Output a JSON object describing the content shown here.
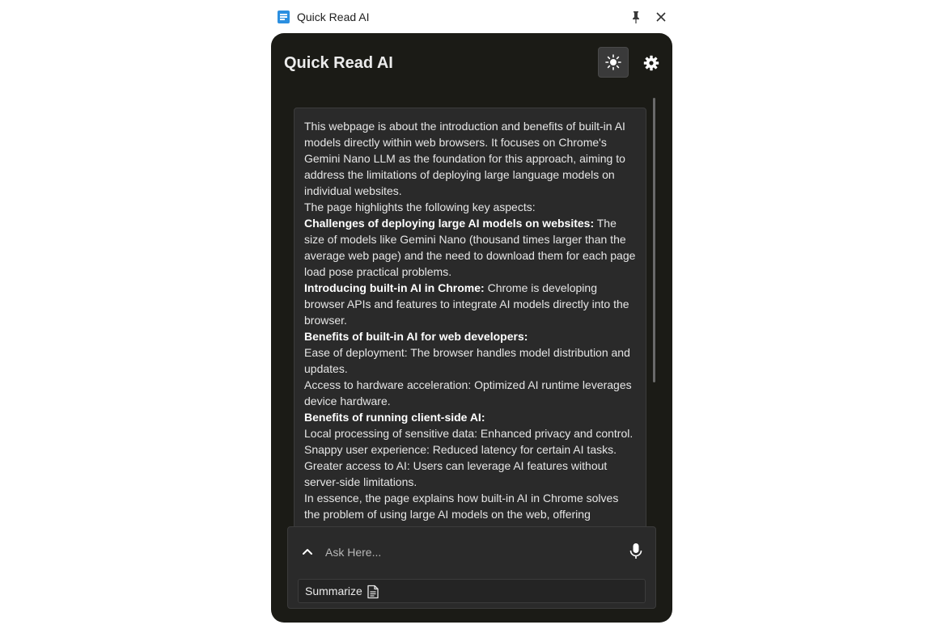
{
  "window": {
    "title": "Quick Read AI"
  },
  "header": {
    "title": "Quick Read AI"
  },
  "icons": {
    "app": "document-icon",
    "pin": "pin-icon",
    "close": "close-icon",
    "theme": "sun-icon",
    "settings": "gear-icon",
    "expand": "chevron-up-icon",
    "mic": "microphone-icon",
    "summarize": "document-icon"
  },
  "content": {
    "intro": "This webpage is about the introduction and benefits of built-in AI models directly within web browsers. It focuses on Chrome's Gemini Nano LLM as the foundation for this approach, aiming to address the limitations of deploying large language models on individual websites.",
    "highlights_intro": "The page highlights the following key aspects:",
    "challenges_heading": "Challenges of deploying large AI models on websites:",
    "challenges_text": " The size of models like Gemini Nano (thousand times larger than the average web page) and the need to download them for each page load pose practical problems.",
    "introducing_heading": "Introducing built-in AI in Chrome:",
    "introducing_text": " Chrome is developing browser APIs and features to integrate AI models directly into the browser.",
    "dev_benefits_heading": "Benefits of built-in AI for web developers:",
    "dev_benefit_1": "Ease of deployment: The browser handles model distribution and updates.",
    "dev_benefit_2": "Access to hardware acceleration: Optimized AI runtime leverages device hardware.",
    "client_benefits_heading": "Benefits of running client-side AI:",
    "client_benefit_1": "Local processing of sensitive data: Enhanced privacy and control.",
    "client_benefit_2": "Snappy user experience: Reduced latency for certain AI tasks.",
    "client_benefit_3": "Greater access to AI: Users can leverage AI features without server-side limitations.",
    "conclusion": "In essence, the page explains how built-in AI in Chrome solves the problem of using large AI models on the web, offering developers"
  },
  "input": {
    "placeholder": "Ask Here..."
  },
  "actions": {
    "summarize_label": "Summarize"
  },
  "colors": {
    "panel_bg": "#1b1b16",
    "card_bg": "#2a2a2a",
    "accent": "#2b8fe0"
  }
}
